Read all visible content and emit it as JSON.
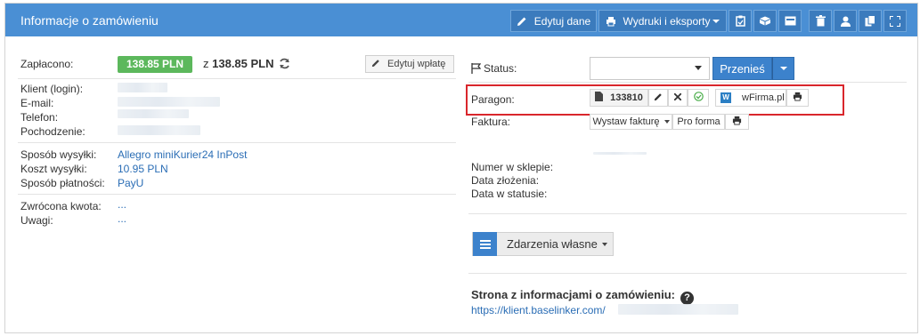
{
  "header": {
    "title": "Informacje o zamówieniu",
    "edit_label": "Edytuj dane",
    "prints_label": "Wydruki i eksporty",
    "icons": [
      "pencil-icon",
      "printer-icon",
      "clipboard-icon",
      "box-icon",
      "card-icon",
      "trash-icon",
      "user-icon",
      "copy-icon",
      "expand-icon"
    ],
    "color": "#4a8fd4"
  },
  "payment": {
    "label": "Zapłacono:",
    "paid_badge": "138.85 PLN",
    "of_prefix": "z",
    "total": "138.85 PLN",
    "edit_payment_label": "Edytuj wpłatę",
    "badge_color": "#5cb85c"
  },
  "client": {
    "login_label": "Klient (login):",
    "email_label": "E-mail:",
    "phone_label": "Telefon:",
    "origin_label": "Pochodzenie:"
  },
  "shipping": {
    "method_label": "Sposób wysyłki:",
    "method_value": "Allegro miniKurier24 InPost",
    "cost_label": "Koszt wysyłki:",
    "cost_value": "10.95 PLN",
    "payment_label": "Sposób płatności:",
    "payment_value": "PayU"
  },
  "extra": {
    "refund_label": "Zwrócona kwota:",
    "refund_value": "...",
    "notes_label": "Uwagi:",
    "notes_value": "..."
  },
  "status": {
    "label": "Status:",
    "selected": "",
    "move_label": "Przenieś"
  },
  "receipt": {
    "label": "Paragon:",
    "number": "133810",
    "service": "wFirma.pl"
  },
  "invoice": {
    "label": "Faktura:",
    "issue_label": "Wystaw fakturę",
    "proforma_label": "Pro forma"
  },
  "store": {
    "number_label": "Numer w sklepie:",
    "date_label": "Data złożenia:",
    "status_date_label": "Data w statusie:"
  },
  "events": {
    "label": "Zdarzenia własne"
  },
  "info_page": {
    "title": "Strona z informacjami o zamówieniu:",
    "url": "https://klient.baselinker.com/"
  }
}
